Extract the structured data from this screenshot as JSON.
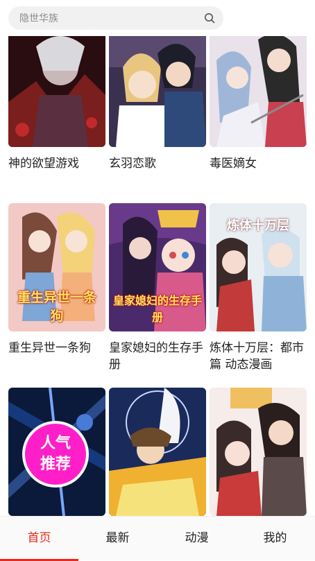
{
  "search": {
    "placeholder": "隐世华族"
  },
  "comics": [
    {
      "title": "神的欲望游戏",
      "palette": [
        "#2a0d10",
        "#7a1e1e",
        "#c02a2a"
      ]
    },
    {
      "title": "玄羽恋歌",
      "palette": [
        "#3a3050",
        "#e8c680",
        "#2e4a7a"
      ]
    },
    {
      "title": "毒医嫡女",
      "palette": [
        "#e9e2ea",
        "#9fb6d8",
        "#c94050"
      ]
    },
    {
      "title": "重生异世一条狗",
      "cover_text": "重生异世一条狗",
      "palette": [
        "#f2c9c4",
        "#7ea6d6",
        "#f3b07a"
      ]
    },
    {
      "title": "皇家媳妇的生存手册",
      "cover_text": "皇家媳妇的生存手册",
      "palette": [
        "#4a2a6a",
        "#d85a8a",
        "#f1c24a"
      ]
    },
    {
      "title": "炼体十万层：都市篇 动态漫画",
      "cover_text": "炼体十万层",
      "palette": [
        "#e8eef2",
        "#8fb3d8",
        "#c23a3a"
      ]
    },
    {
      "title": "",
      "badge": "人气\n推荐",
      "palette": [
        "#0b1a3a",
        "#1d4fa8",
        "#4a7ad8"
      ]
    },
    {
      "title": "",
      "palette": [
        "#1a2a5a",
        "#f0b030",
        "#f6e27a"
      ]
    },
    {
      "title": "",
      "palette": [
        "#f6ecea",
        "#c93a3a",
        "#3a2a2a"
      ]
    }
  ],
  "tabs": [
    {
      "label": "首页",
      "active": true
    },
    {
      "label": "最新",
      "active": false
    },
    {
      "label": "动漫",
      "active": false
    },
    {
      "label": "我的",
      "active": false
    }
  ],
  "colors": {
    "accent": "#e8291c"
  }
}
